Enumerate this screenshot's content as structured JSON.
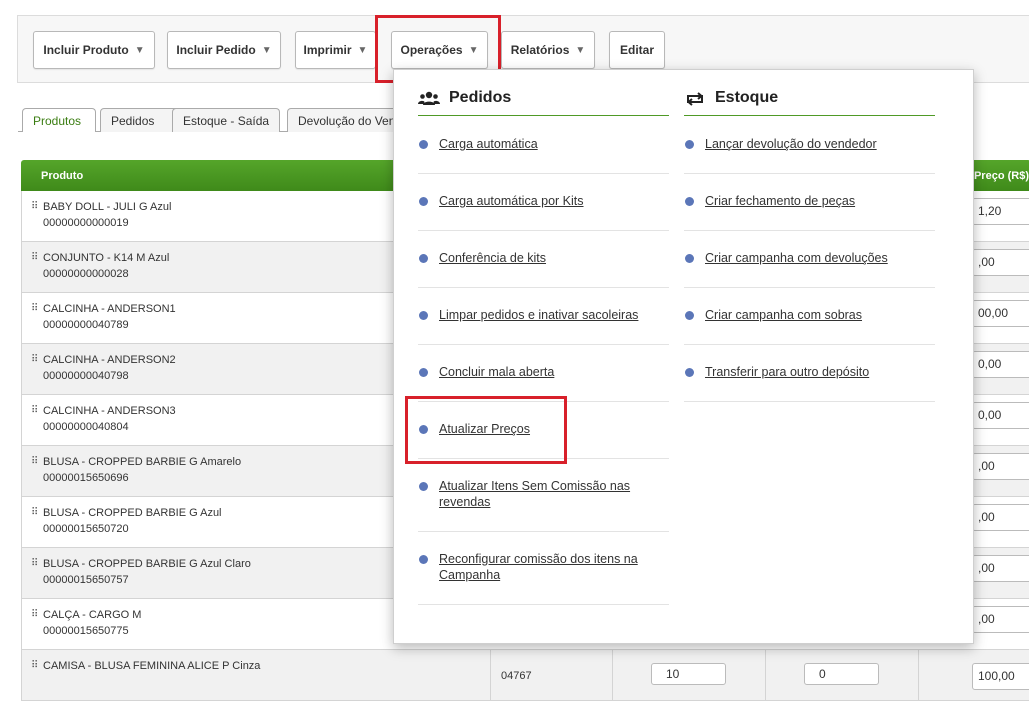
{
  "toolbar": {
    "buttons": [
      {
        "label": "Incluir Produto",
        "caret": "▼"
      },
      {
        "label": "Incluir Pedido",
        "caret": "▼"
      },
      {
        "label": "Imprimir",
        "caret": "▼"
      },
      {
        "label": "Operações",
        "caret": "▼"
      },
      {
        "label": "Relatórios",
        "caret": "▼"
      },
      {
        "label": "Editar"
      }
    ]
  },
  "tabs": [
    "Produtos",
    "Pedidos",
    "Estoque - Saída",
    "Devolução do Vendedor"
  ],
  "table": {
    "headers": {
      "produto": "Produto",
      "preco": "Preço (R$)"
    },
    "rows": [
      {
        "name": "BABY DOLL - JULI G Azul",
        "code": "00000000000019",
        "price": "1,20"
      },
      {
        "name": "CONJUNTO - K14 M Azul",
        "code": "00000000000028",
        "price": ",00"
      },
      {
        "name": "CALCINHA - ANDERSON1",
        "code": "00000000040789",
        "price": "00,00"
      },
      {
        "name": "CALCINHA - ANDERSON2",
        "code": "00000000040798",
        "price": "0,00"
      },
      {
        "name": "CALCINHA - ANDERSON3",
        "code": "00000000040804",
        "price": "0,00"
      },
      {
        "name": "BLUSA - CROPPED BARBIE G Amarelo",
        "code": "00000015650696",
        "price": ",00"
      },
      {
        "name": "BLUSA - CROPPED BARBIE G Azul",
        "code": "00000015650720",
        "price": ",00"
      },
      {
        "name": "BLUSA - CROPPED BARBIE G Azul Claro",
        "code": "00000015650757",
        "price": ",00"
      },
      {
        "name": "CALÇA - CARGO M",
        "code": "00000015650775",
        "price": ",00"
      },
      {
        "name": "CAMISA - BLUSA FEMININA ALICE P Cinza",
        "code": "",
        "price": "100,00",
        "ref": "04767",
        "qty": "10",
        "comm": "0"
      }
    ]
  },
  "menu": {
    "pedidos": {
      "title": "Pedidos",
      "items": [
        "Carga automática",
        "Carga automática por Kits",
        "Conferência de kits",
        "Limpar pedidos e inativar sacoleiras",
        "Concluir mala aberta",
        "Atualizar Preços",
        "Atualizar Itens Sem Comissão nas revendas",
        "Reconfigurar comissão dos itens na Campanha"
      ]
    },
    "estoque": {
      "title": "Estoque",
      "items": [
        "Lançar devolução do vendedor",
        "Criar fechamento de peças",
        "Criar campanha com devoluções",
        "Criar campanha com sobras",
        "Transferir para outro depósito"
      ]
    }
  },
  "colors": {
    "accent_green": "#4f9a26",
    "highlight_red": "#d8202a",
    "bullet_blue": "#5b76b8"
  },
  "icons": {
    "pedidos": "users-icon",
    "estoque": "transfer-arrows-icon"
  }
}
